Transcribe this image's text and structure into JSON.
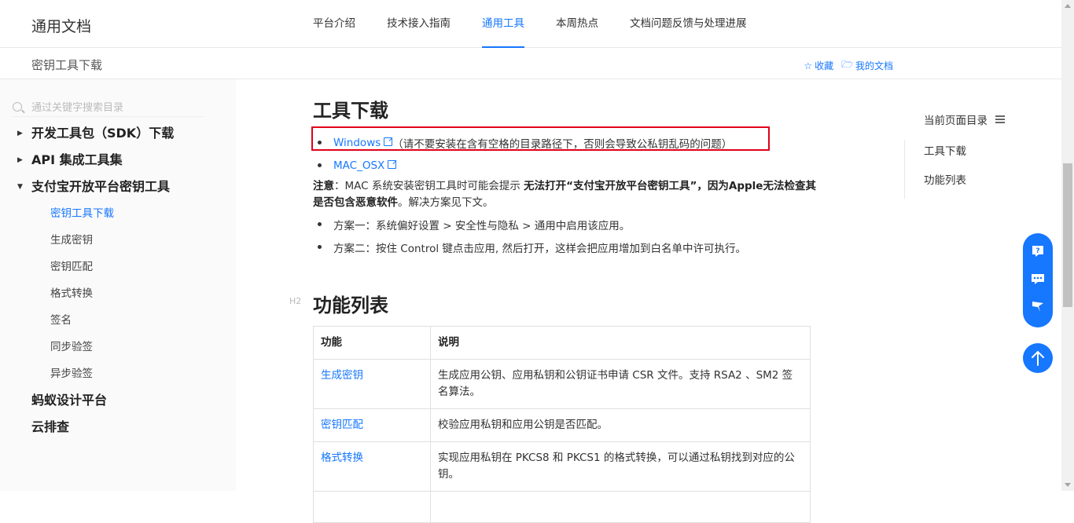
{
  "header": {
    "logo": "通用文档",
    "nav": [
      "平台介绍",
      "技术接入指南",
      "通用工具",
      "本周热点",
      "文档问题反馈与处理进展"
    ],
    "active_nav": "通用工具"
  },
  "subheader": {
    "title": "密钥工具下载",
    "favorite_label": "收藏",
    "my_docs_label": "我的文档"
  },
  "sidebar": {
    "search_placeholder": "通过关键字搜索目录",
    "groups": [
      {
        "label": "开发工具包（SDK）下载",
        "expanded": false
      },
      {
        "label": "API 集成工具集",
        "expanded": false
      },
      {
        "label": "支付宝开放平台密钥工具",
        "expanded": true
      }
    ],
    "children": [
      "密钥工具下载",
      "生成密钥",
      "密钥匹配",
      "格式转换",
      "签名",
      "同步验签",
      "异步验签"
    ],
    "active_child": "密钥工具下载",
    "others": [
      "蚂蚁设计平台",
      "云排查"
    ]
  },
  "content": {
    "h_tools": "工具下载",
    "windows_link": "Windows",
    "windows_note": "（请不要安装在含有空格的目录路径下，否则会导致公私钥乱码的问题）",
    "mac_link": "MAC_OSX",
    "note_label": "注意",
    "note_text1": "：MAC 系统安装密钥工具时可能会提示 ",
    "note_bold1": "无法打开“支付宝开放平台密钥工具”，因为Apple无法检查其是否包含恶意软件",
    "note_text2": "。解决方案见下文。",
    "plan1": "方案一：系统偏好设置 > 安全性与隐私 > 通用中启用该应用。",
    "plan2": "方案二：按住 Control 键点击应用, 然后打开，这样会把应用增加到白名单中许可执行。",
    "h2_tag": "H2",
    "h_func": "功能列表",
    "table": {
      "headers": [
        "功能",
        "说明"
      ],
      "rows": [
        [
          "生成密钥",
          "生成应用公钥、应用私钥和公钥证书申请 CSR 文件。支持 RSA2 、SM2 签名算法。"
        ],
        [
          "密钥匹配",
          "校验应用私钥和应用公钥是否匹配。"
        ],
        [
          "格式转换",
          "实现应用私钥在 PKCS8 和 PKCS1 的格式转换，可以通过私钥找到对应的公钥。"
        ]
      ]
    }
  },
  "toc": {
    "title": "当前页面目录",
    "items": [
      "工具下载",
      "功能列表"
    ]
  },
  "colors": {
    "accent": "#1677ff",
    "highlight_box": "#e0001b"
  }
}
